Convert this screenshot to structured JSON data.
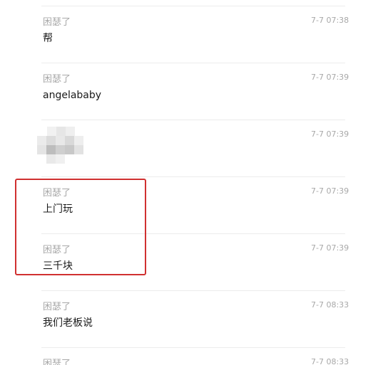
{
  "messages": [
    {
      "sender": "困瑟了",
      "time": "7-7 07:38",
      "text": "帮"
    },
    {
      "sender": "",
      "time": "7-7 07:39",
      "text": "angelababy"
    },
    {
      "sender": "",
      "time": "7-7 07:39",
      "text": ""
    },
    {
      "sender": "困瑟了",
      "time": "7-7 07:39",
      "text": "上门玩"
    },
    {
      "sender": "困瑟了",
      "time": "7-7 07:39",
      "text": "三千块"
    },
    {
      "sender": "困瑟了",
      "time": "7-7 08:33",
      "text": "我们老板说"
    },
    {
      "sender": "困瑟了",
      "time": "7-7 08:33",
      "text": ""
    }
  ],
  "sender_name_row2": "困瑟了",
  "colors": {
    "highlight_border": "#d03030",
    "meta_text": "#a8a8a8",
    "body_text": "#1a1a1a",
    "divider": "#ececec"
  },
  "blurred_image_icon": "pixelated-image-icon"
}
